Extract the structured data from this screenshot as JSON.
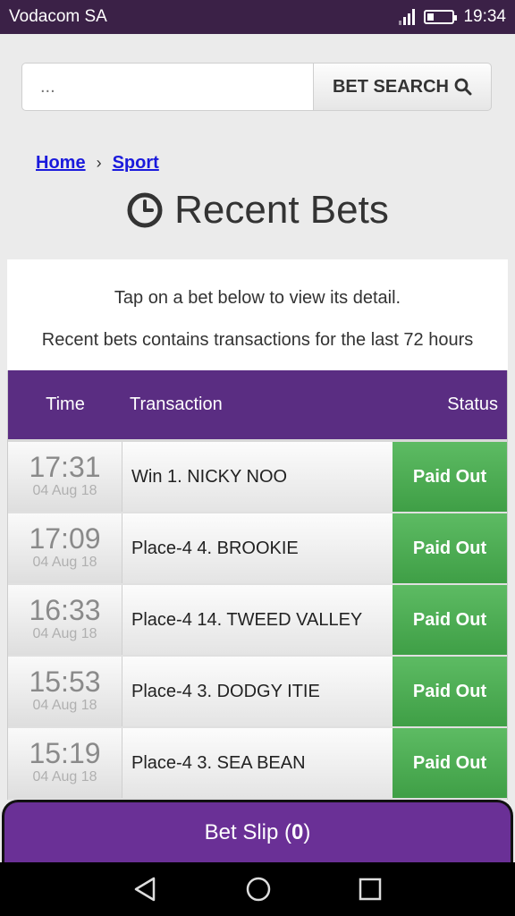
{
  "status_bar": {
    "carrier": "Vodacom SA",
    "time": "19:34",
    "battery_fraction": 0.25,
    "signal_bars": 3
  },
  "search": {
    "placeholder": "...",
    "button_label": "BET SEARCH"
  },
  "breadcrumb": {
    "home": "Home",
    "separator": "›",
    "sport": "Sport"
  },
  "page_title": "Recent Bets",
  "info": {
    "line1": "Tap on a bet below to view its detail.",
    "line2": "Recent bets contains transactions for the last 72 hours"
  },
  "table": {
    "headers": {
      "time": "Time",
      "transaction": "Transaction",
      "status": "Status"
    },
    "rows": [
      {
        "time": "17:31",
        "date": "04 Aug 18",
        "transaction": "Win 1. NICKY NOO",
        "status": "Paid Out"
      },
      {
        "time": "17:09",
        "date": "04 Aug 18",
        "transaction": "Place-4 4. BROOKIE",
        "status": "Paid Out"
      },
      {
        "time": "16:33",
        "date": "04 Aug 18",
        "transaction": "Place-4 14. TWEED VALLEY",
        "status": "Paid Out"
      },
      {
        "time": "15:53",
        "date": "04 Aug 18",
        "transaction": "Place-4 3. DODGY ITIE",
        "status": "Paid Out"
      },
      {
        "time": "15:19",
        "date": "04 Aug 18",
        "transaction": "Place-4 3. SEA BEAN",
        "status": "Paid Out"
      }
    ]
  },
  "bet_slip": {
    "label": "Bet Slip",
    "count": "0"
  },
  "colors": {
    "header_purple": "#5a2d82",
    "bet_slip_purple": "#6a3096",
    "paid_green": "#4caf50",
    "link_blue": "#1a1adc"
  },
  "icons": {
    "search": "search-icon",
    "clock": "clock-icon",
    "back": "back-icon",
    "home": "home-icon",
    "recents": "recents-icon"
  }
}
